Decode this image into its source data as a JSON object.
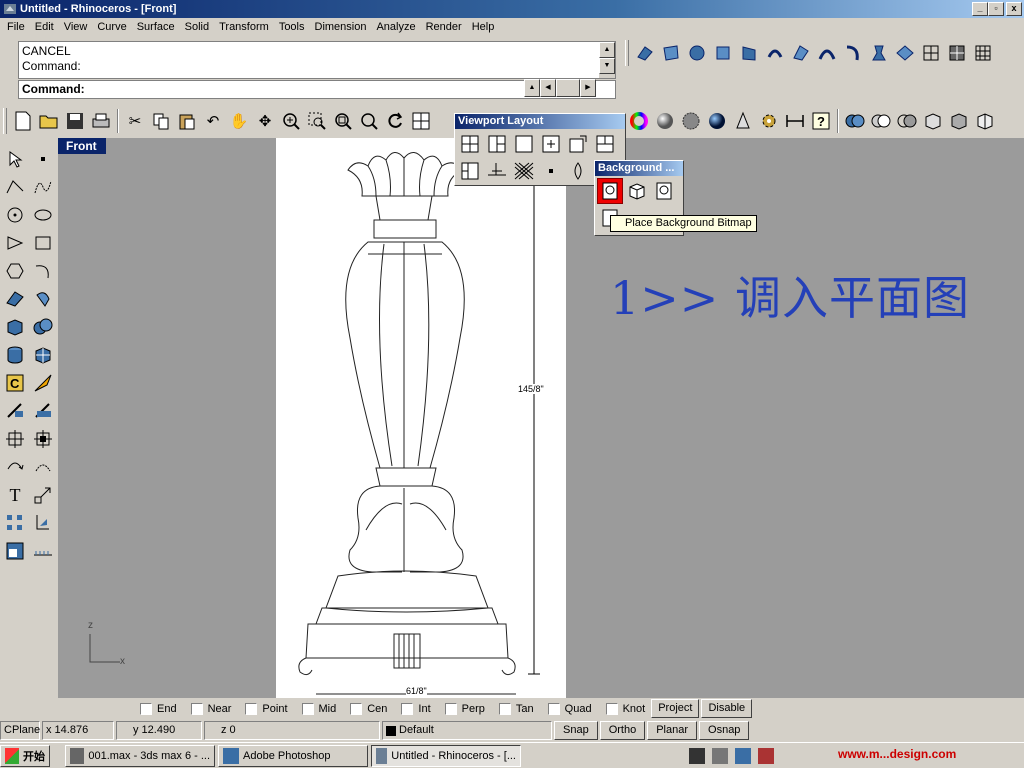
{
  "window": {
    "title": "Untitled - Rhinoceros - [Front]",
    "min": "_",
    "restore": "▫",
    "close": "x"
  },
  "menu": [
    "File",
    "Edit",
    "View",
    "Curve",
    "Surface",
    "Solid",
    "Transform",
    "Tools",
    "Dimension",
    "Analyze",
    "Render",
    "Help"
  ],
  "command": {
    "history": [
      "CANCEL",
      "Command:"
    ],
    "prompt": "Command:"
  },
  "viewport": {
    "label": "Front",
    "note": "1>> 调入平面图",
    "dimension_height": "145/8\"",
    "dimension_width": "61/8\"",
    "axis_z": "z",
    "axis_x": "x"
  },
  "panels": {
    "viewport_layout": {
      "title": "Viewport Layout"
    },
    "background": {
      "title": "Background ..."
    },
    "tooltip": "Place Background Bitmap"
  },
  "osnap": {
    "items": [
      "End",
      "Near",
      "Point",
      "Mid",
      "Cen",
      "Int",
      "Perp",
      "Tan",
      "Quad",
      "Knot"
    ],
    "project": "Project",
    "disable": "Disable"
  },
  "status": {
    "cplane": "CPlane",
    "x": "x 14.876",
    "y": "y 12.490",
    "z": "z 0",
    "layer": "Default",
    "snap": "Snap",
    "ortho": "Ortho",
    "planar": "Planar",
    "osnap": "Osnap"
  },
  "taskbar": {
    "start": "开始",
    "tasks": [
      "001.max - 3ds max 6 - ...",
      "Adobe Photoshop",
      "Untitled - Rhinoceros - [..."
    ],
    "watermark": "www.m...design.com"
  },
  "colors": {
    "titlebar": "#0a246a",
    "viewport_bg": "#9b9b9b",
    "note": "#2440b8",
    "pressed": "#ee0000"
  }
}
